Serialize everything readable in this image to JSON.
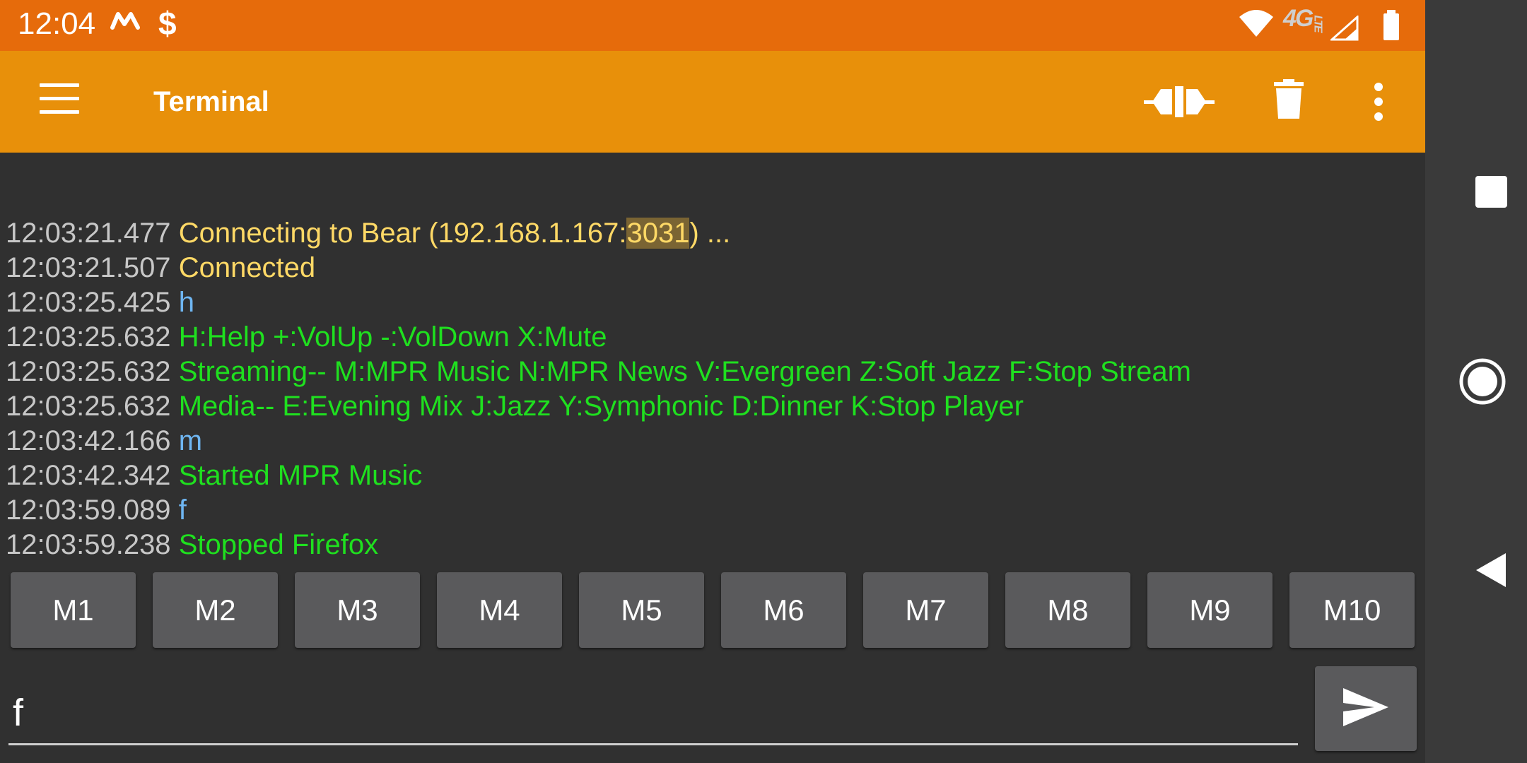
{
  "status_bar": {
    "time": "12:04",
    "network_label": "4G",
    "network_sublabel": "LTE",
    "icons": [
      "m-notification-icon",
      "dollar-notification-icon",
      "wifi-icon",
      "signal-icon",
      "battery-icon"
    ]
  },
  "app_bar": {
    "title": "Terminal",
    "menu_icon": "hamburger-menu-icon",
    "actions": [
      "connect-icon",
      "delete-icon",
      "more-options-icon"
    ]
  },
  "terminal": {
    "lines": [
      {
        "ts": "12:03:21.477",
        "pre": "Connecting to Bear (192.168.1.167:",
        "highlight": "3031",
        "post": ") ...",
        "color": "#FFD966"
      },
      {
        "ts": "12:03:21.507",
        "text": "Connected",
        "color": "#FFD966"
      },
      {
        "ts": "12:03:25.425",
        "text": "h",
        "color": "#6FB6F2"
      },
      {
        "ts": "12:03:25.632",
        "text": "H:Help +:VolUp -:VolDown X:Mute",
        "color": "#1FE01F"
      },
      {
        "ts": "12:03:25.632",
        "text": "Streaming-- M:MPR Music N:MPR News V:Evergreen Z:Soft Jazz F:Stop Stream",
        "color": "#1FE01F"
      },
      {
        "ts": "12:03:25.632",
        "text": "Media-- E:Evening Mix J:Jazz Y:Symphonic D:Dinner K:Stop Player",
        "color": "#1FE01F"
      },
      {
        "ts": "12:03:42.166",
        "text": "m",
        "color": "#6FB6F2"
      },
      {
        "ts": "12:03:42.342",
        "text": "Started MPR Music",
        "color": "#1FE01F"
      },
      {
        "ts": "12:03:59.089",
        "text": "f",
        "color": "#6FB6F2"
      },
      {
        "ts": "12:03:59.238",
        "text": "Stopped Firefox",
        "color": "#1FE01F"
      }
    ]
  },
  "macros": [
    "M1",
    "M2",
    "M3",
    "M4",
    "M5",
    "M6",
    "M7",
    "M8",
    "M9",
    "M10"
  ],
  "input": {
    "value": "f"
  },
  "send_button": {
    "icon": "send-icon"
  },
  "nav_bar": {
    "icons": [
      "recents-icon",
      "home-icon",
      "back-icon"
    ]
  },
  "colors": {
    "status_bar": "#E66B0B",
    "app_bar": "#E8900A",
    "background": "#303030",
    "button": "#5A5A5C",
    "timestamp": "#C7C7C7",
    "info_yellow": "#FFD966",
    "response_green": "#1FE01F",
    "sent_blue": "#6FB6F2"
  }
}
